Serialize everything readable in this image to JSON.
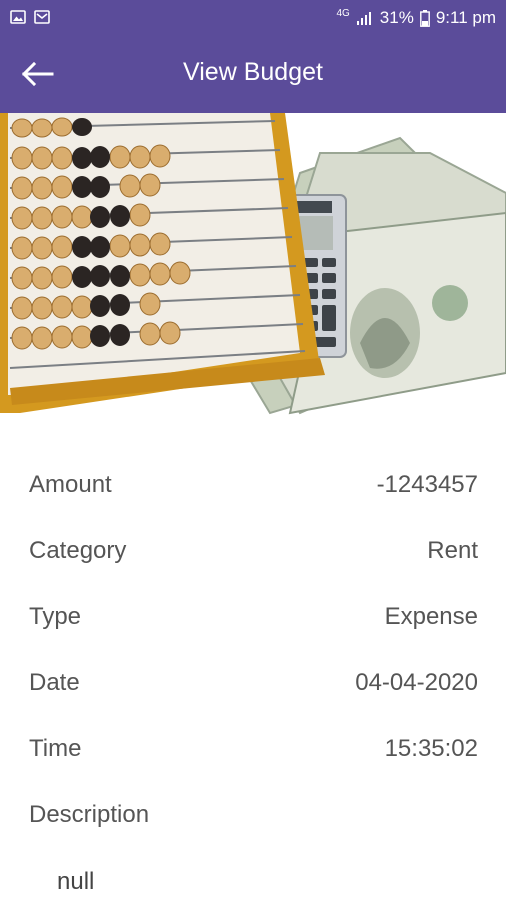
{
  "status_bar": {
    "battery": "31%",
    "time": "9:11 pm",
    "network": "4G"
  },
  "app_bar": {
    "title": "View Budget"
  },
  "details": {
    "amount": {
      "label": "Amount",
      "value": "-1243457"
    },
    "category": {
      "label": "Category",
      "value": "Rent"
    },
    "type": {
      "label": "Type",
      "value": "Expense"
    },
    "date": {
      "label": "Date",
      "value": "04-04-2020"
    },
    "time": {
      "label": "Time",
      "value": "15:35:02"
    },
    "description": {
      "label": "Description",
      "value": "null"
    }
  },
  "colors": {
    "primary": "#5b4c9a",
    "text": "#555555"
  }
}
